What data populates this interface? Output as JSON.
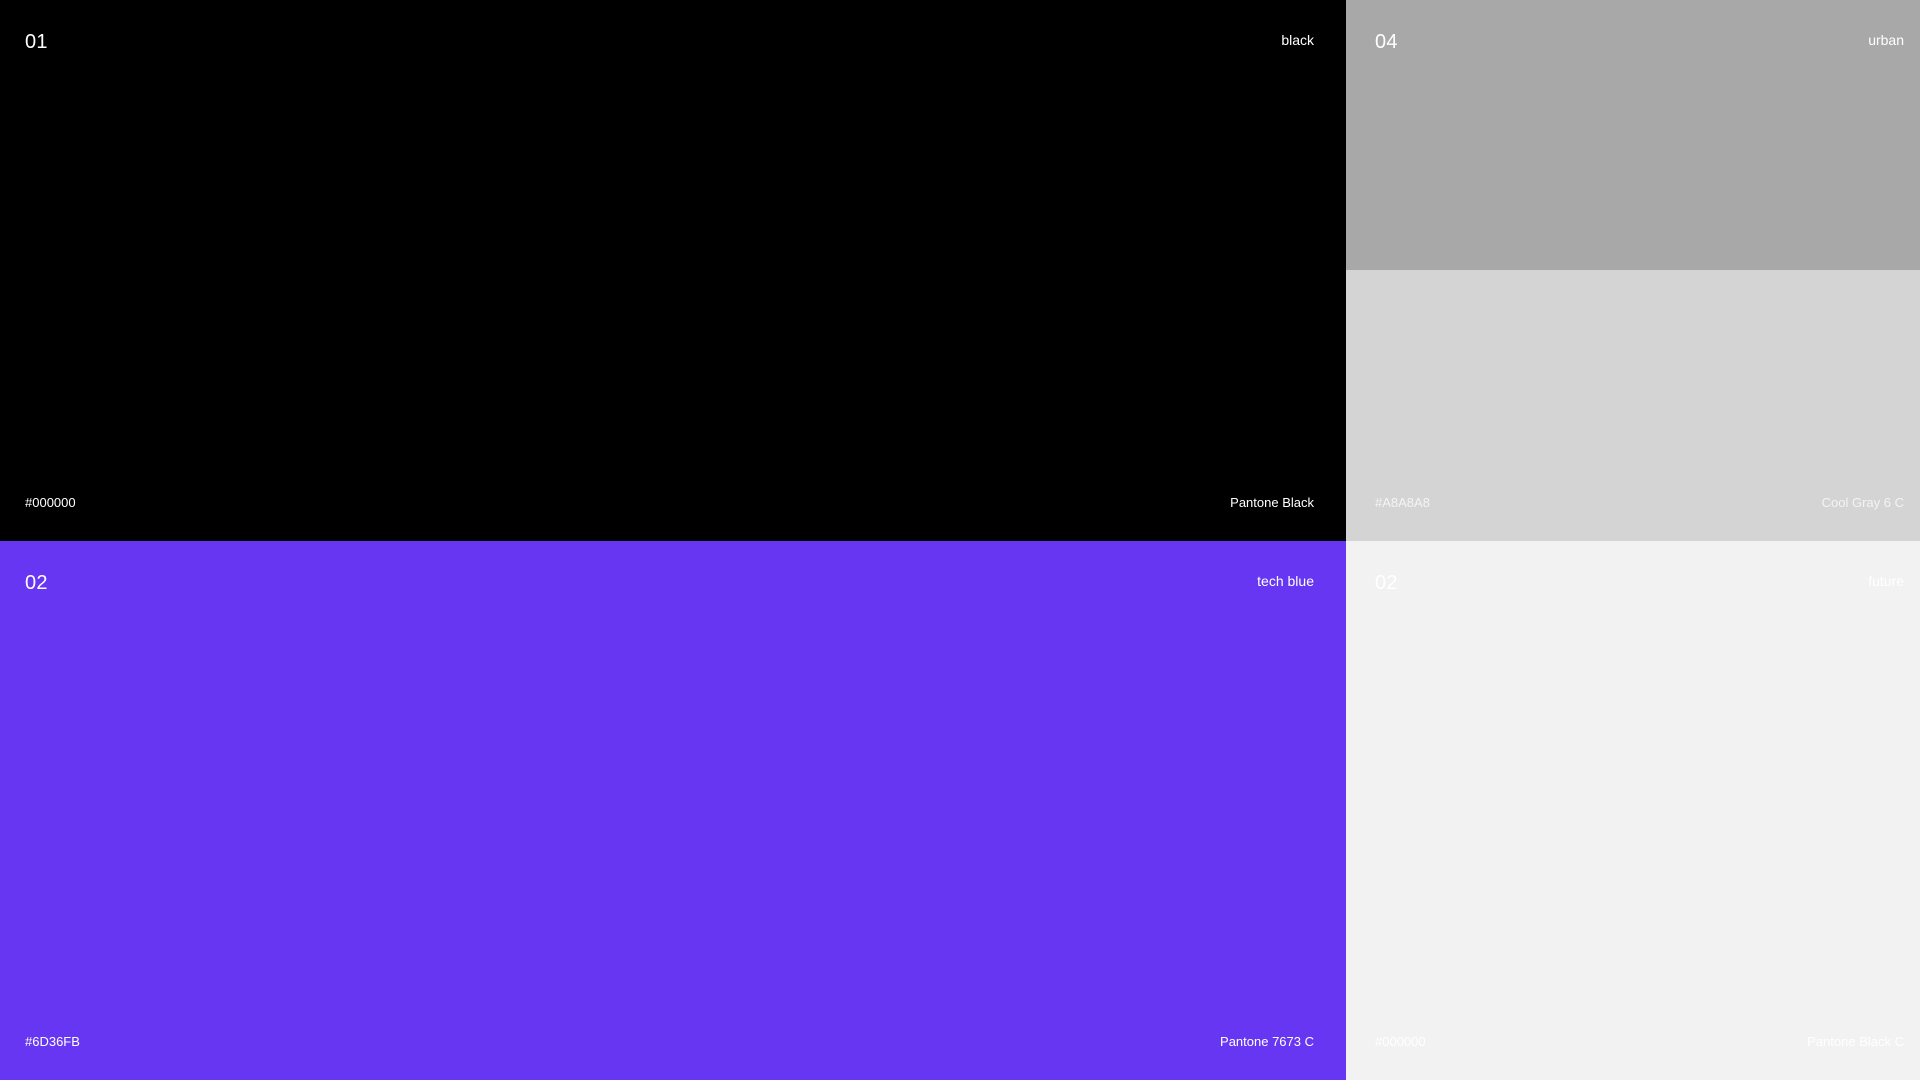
{
  "tiles": {
    "black": {
      "number": "01",
      "name": "black",
      "hex": "#000000",
      "pantone": "Pantone Black",
      "bg": "#000000",
      "text_color": "#ffffff"
    },
    "tech_blue": {
      "number": "02",
      "name": "tech blue",
      "hex": "#6D36FB",
      "pantone": "Pantone 7673 C",
      "bg": "#6736F2",
      "text_color": "#ffffff"
    },
    "urban": {
      "number": "04",
      "name": "urban",
      "bg": "#A8A8A8",
      "text_color": "#ffffff"
    },
    "urban_light": {
      "hex": "#A8A8A8",
      "pantone": "Cool Gray 6 C",
      "bg": "#D4D4D4",
      "text_color": "#f4f4f4"
    },
    "future": {
      "number": "02",
      "name": "future",
      "hex": "#000000",
      "pantone": "Pantone Black C",
      "bg": "#F2F2F2",
      "text_color": "#ffffff"
    }
  }
}
